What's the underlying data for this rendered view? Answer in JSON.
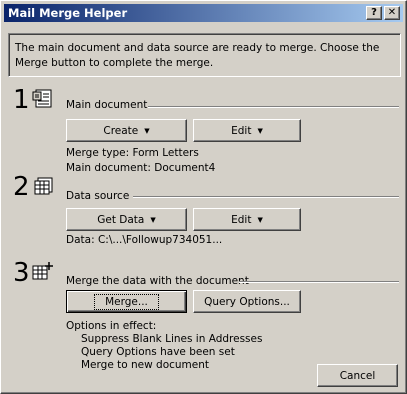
{
  "window": {
    "title": "Mail Merge Helper",
    "help_glyph": "?",
    "close_glyph": "✕"
  },
  "info": {
    "text": "The main document and data source are ready to merge. Choose the Merge button to complete the merge."
  },
  "steps": [
    {
      "number": "1",
      "icon": "main-document-icon",
      "label": "Main document",
      "buttons": [
        {
          "label": "Create",
          "dropdown": true
        },
        {
          "label": "Edit",
          "dropdown": true
        }
      ],
      "details": [
        "Merge type: Form Letters",
        "Main document: Document4"
      ]
    },
    {
      "number": "2",
      "icon": "data-source-icon",
      "label": "Data source",
      "buttons": [
        {
          "label": "Get Data",
          "dropdown": true
        },
        {
          "label": "Edit",
          "dropdown": true
        }
      ],
      "details": [
        "Data: C:\\...\\Followup734051..."
      ]
    },
    {
      "number": "3",
      "icon": "merge-icon",
      "label": "Merge the data with the document",
      "buttons": [
        {
          "label": "Merge...",
          "dropdown": false
        },
        {
          "label": "Query Options...",
          "dropdown": false
        }
      ],
      "options_heading": "Options in effect:",
      "options": [
        "Suppress Blank Lines in Addresses",
        "Query Options have been set",
        "Merge to new document"
      ]
    }
  ],
  "footer": {
    "cancel_label": "Cancel"
  },
  "colors": {
    "dialog_face": "#d4d0c8",
    "titlebar_start": "#0a246a",
    "titlebar_end": "#a6caf0"
  }
}
